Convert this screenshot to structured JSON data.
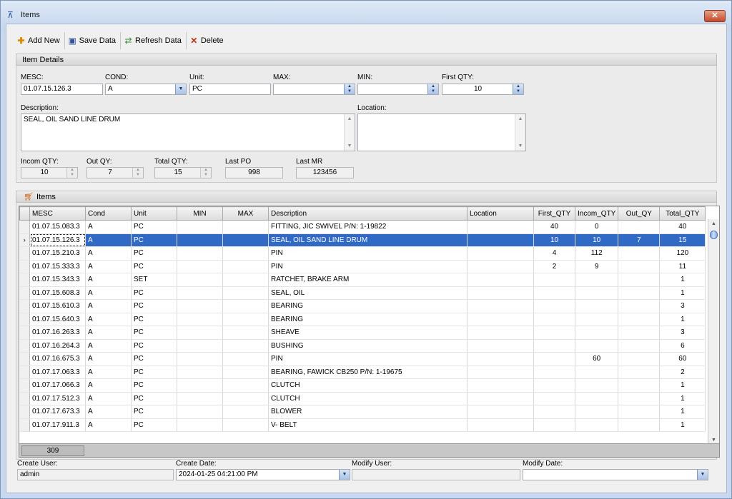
{
  "window": {
    "title": "Items"
  },
  "toolbar": {
    "add_new": "Add New",
    "save_data": "Save Data",
    "refresh_data": "Refresh Data",
    "delete": "Delete"
  },
  "details": {
    "group_title": "Item Details",
    "mesc_label": "MESC:",
    "mesc_value": "01.07.15.126.3",
    "cond_label": "COND:",
    "cond_value": "A",
    "unit_label": "Unit:",
    "unit_value": "PC",
    "max_label": "MAX:",
    "max_value": "",
    "min_label": "MIN:",
    "min_value": "",
    "first_qty_label": "First QTY:",
    "first_qty_value": "10",
    "description_label": "Description:",
    "description_value": "SEAL, OIL SAND LINE DRUM",
    "location_label": "Location:",
    "location_value": "",
    "incom_qty_label": "Incom QTY:",
    "incom_qty_value": "10",
    "out_qy_label": "Out QY:",
    "out_qy_value": "7",
    "total_qty_label": "Total QTY:",
    "total_qty_value": "15",
    "last_po_label": "Last PO",
    "last_po_value": "998",
    "last_mr_label": "Last MR",
    "last_mr_value": "123456"
  },
  "items_group": {
    "title": "Items"
  },
  "grid": {
    "columns": [
      "MESC",
      "Cond",
      "Unit",
      "MIN",
      "MAX",
      "Description",
      "Location",
      "First_QTY",
      "Incom_QTY",
      "Out_QY",
      "Total_QTY"
    ],
    "rows": [
      [
        "01.07.15.083.3",
        "A",
        "PC",
        "",
        "",
        "FITTING, JIC SWIVEL   P/N: 1-19822",
        "",
        "40",
        "0",
        "",
        "40"
      ],
      [
        "01.07.15.126.3",
        "A",
        "PC",
        "",
        "",
        "SEAL, OIL SAND LINE DRUM",
        "",
        "10",
        "10",
        "7",
        "15"
      ],
      [
        "01.07.15.210.3",
        "A",
        "PC",
        "",
        "",
        "PIN",
        "",
        "4",
        "112",
        "",
        "120"
      ],
      [
        "01.07.15.333.3",
        "A",
        "PC",
        "",
        "",
        "PIN",
        "",
        "2",
        "9",
        "",
        "11"
      ],
      [
        "01.07.15.343.3",
        "A",
        "SET",
        "",
        "",
        "RATCHET, BRAKE ARM",
        "",
        "",
        "",
        "",
        "1"
      ],
      [
        "01.07.15.608.3",
        "A",
        "PC",
        "",
        "",
        "SEAL, OIL",
        "",
        "",
        "",
        "",
        "1"
      ],
      [
        "01.07.15.610.3",
        "A",
        "PC",
        "",
        "",
        "BEARING",
        "",
        "",
        "",
        "",
        "3"
      ],
      [
        "01.07.15.640.3",
        "A",
        "PC",
        "",
        "",
        "BEARING",
        "",
        "",
        "",
        "",
        "1"
      ],
      [
        "01.07.16.263.3",
        "A",
        "PC",
        "",
        "",
        "SHEAVE",
        "",
        "",
        "",
        "",
        "3"
      ],
      [
        "01.07.16.264.3",
        "A",
        "PC",
        "",
        "",
        "BUSHING",
        "",
        "",
        "",
        "",
        "6"
      ],
      [
        "01.07.16.675.3",
        "A",
        "PC",
        "",
        "",
        "PIN",
        "",
        "",
        "60",
        "",
        "60"
      ],
      [
        "01.07.17.063.3",
        "A",
        "PC",
        "",
        "",
        "BEARING, FAWICK CB250    P/N:  1-19675",
        "",
        "",
        "",
        "",
        "2"
      ],
      [
        "01.07.17.066.3",
        "A",
        "PC",
        "",
        "",
        "CLUTCH",
        "",
        "",
        "",
        "",
        "1"
      ],
      [
        "01.07.17.512.3",
        "A",
        "PC",
        "",
        "",
        "CLUTCH",
        "",
        "",
        "",
        "",
        "1"
      ],
      [
        "01.07.17.673.3",
        "A",
        "PC",
        "",
        "",
        "BLOWER",
        "",
        "",
        "",
        "",
        "1"
      ],
      [
        "01.07.17.911.3",
        "A",
        "PC",
        "",
        "",
        "V- BELT",
        "",
        "",
        "",
        "",
        "1"
      ]
    ],
    "selected_index": 1,
    "row_count": "309"
  },
  "audit": {
    "create_user_label": "Create User:",
    "create_user_value": "admin",
    "create_date_label": "Create Date:",
    "create_date_value": "2024-01-25 04:21:00 PM",
    "modify_user_label": "Modify  User:",
    "modify_user_value": "",
    "modify_date_label": "Modify  Date:",
    "modify_date_value": ""
  }
}
